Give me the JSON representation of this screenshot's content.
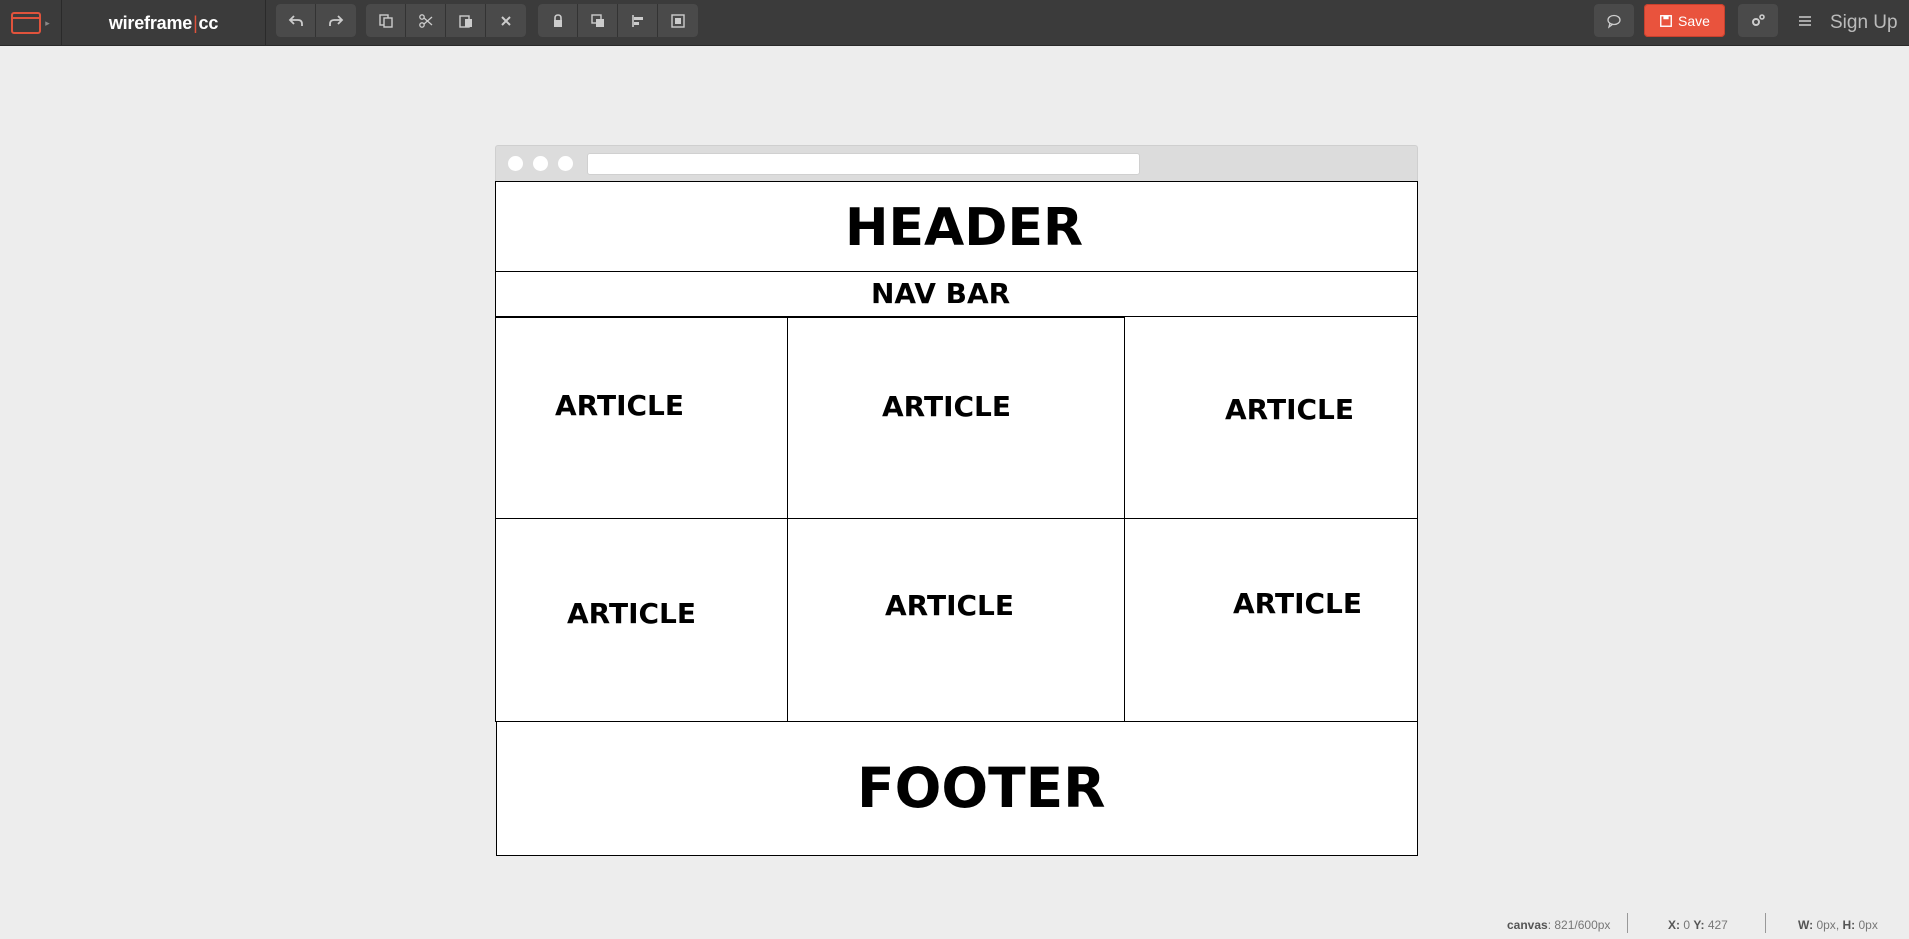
{
  "app": {
    "brand_left": "wireframe",
    "brand_sep": "|",
    "brand_right": "cc"
  },
  "toolbar": {
    "history": [
      "undo-icon",
      "redo-icon"
    ],
    "clipboard": [
      "copy-icon",
      "cut-icon",
      "paste-icon",
      "delete-icon"
    ],
    "arrange": [
      "lock-icon",
      "bring-to-front-icon",
      "align-icon",
      "group-icon"
    ],
    "save_label": "Save",
    "signup_label": "Sign Up",
    "accent_color": "#e9533d"
  },
  "wireframe": {
    "header": "HEADER",
    "nav": "NAV BAR",
    "articles": [
      "ARTICLE",
      "ARTICLE",
      "ARTICLE",
      "ARTICLE",
      "ARTICLE",
      "ARTICLE"
    ],
    "footer": "FOOTER"
  },
  "status": {
    "canvas_label": "canvas",
    "canvas_value": "821/600px",
    "coords_label": "X:",
    "x_value": "0",
    "y_label": "Y:",
    "y_value": "427",
    "w_label": "W:",
    "w_value": "0px",
    "h_label": "H:",
    "h_value": "0px"
  }
}
